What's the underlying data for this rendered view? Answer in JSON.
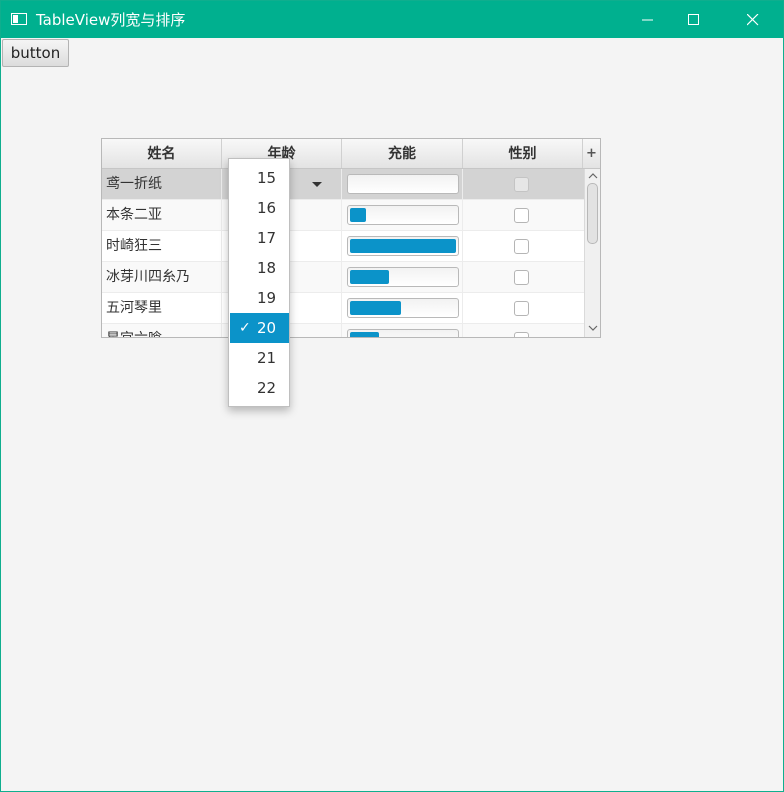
{
  "window": {
    "title": "TableView列宽与排序"
  },
  "toolbar": {
    "button_label": "button"
  },
  "table": {
    "columns": [
      "姓名",
      "年龄",
      "充能",
      "性别"
    ],
    "corner_symbol": "+",
    "rows": [
      {
        "name": "鸢一折纸",
        "progress": 0.0,
        "checked": false,
        "selected": true
      },
      {
        "name": "本条二亚",
        "progress": 0.15,
        "checked": false
      },
      {
        "name": "时崎狂三",
        "progress": 1.0,
        "checked": false
      },
      {
        "name": "冰芽川四糸乃",
        "progress": 0.37,
        "checked": false
      },
      {
        "name": "五河琴里",
        "progress": 0.48,
        "checked": false
      },
      {
        "name": "星宫六喰",
        "progress": 0.27,
        "checked": false
      }
    ]
  },
  "age_dropdown": {
    "options": [
      "15",
      "16",
      "17",
      "18",
      "19",
      "20",
      "21",
      "22"
    ],
    "selected": "20",
    "check_mark": "✓"
  },
  "colors": {
    "titlebar": "#00b08f",
    "accent": "#0b93c9"
  }
}
